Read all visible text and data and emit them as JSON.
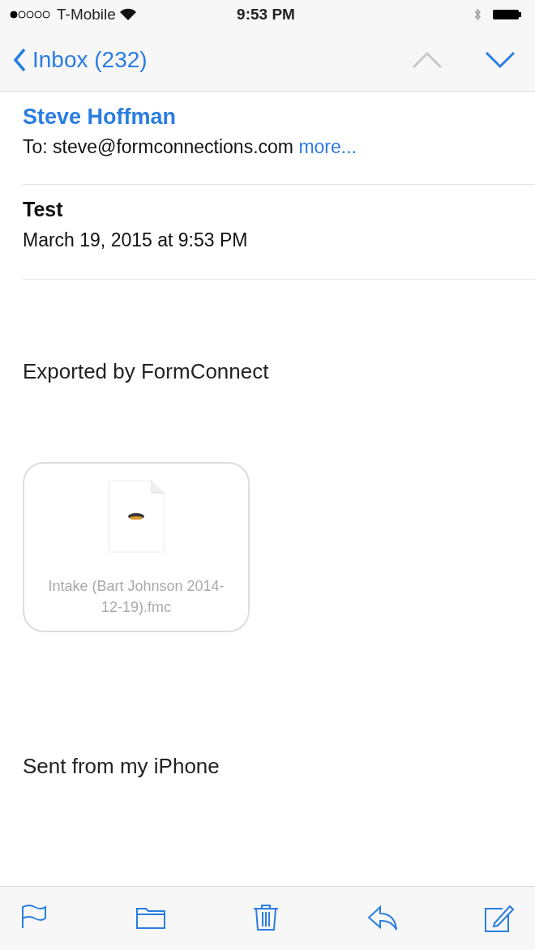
{
  "status_bar": {
    "carrier": "T-Mobile",
    "time": "9:53 PM"
  },
  "nav": {
    "back_label": "Inbox (232)",
    "previous_disabled": true,
    "next_disabled": false
  },
  "header": {
    "sender": "Steve Hoffman",
    "to": "To: steve@formconnections.com",
    "more_link": "more..."
  },
  "subject": {
    "title": "Test",
    "date": "March 19, 2015 at 9:53 PM"
  },
  "body": {
    "text": "Exported by FormConnect",
    "attachment": {
      "file_name": "Intake (Bart Johnson 2014-12-19).fmc"
    },
    "signature": "Sent from my iPhone"
  },
  "toolbar": {
    "buttons": [
      {
        "kind": "flag"
      },
      {
        "kind": "folder"
      },
      {
        "kind": "trash"
      },
      {
        "kind": "reply"
      },
      {
        "kind": "compose"
      }
    ]
  }
}
